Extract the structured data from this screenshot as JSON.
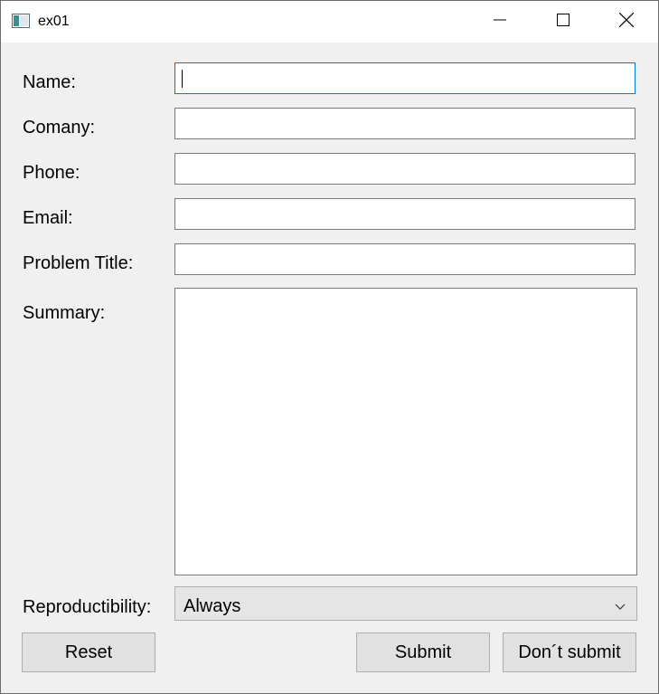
{
  "window": {
    "title": "ex01",
    "icon": "app-window-icon",
    "controls": {
      "minimize": "minimize-icon",
      "maximize": "maximize-icon",
      "close": "close-icon"
    }
  },
  "form": {
    "labels": {
      "name": "Name:",
      "company": "Comany:",
      "phone": "Phone:",
      "email": "Email:",
      "problem_title": "Problem Title:",
      "summary": "Summary:",
      "reproductibility": "Reproductibility:"
    },
    "values": {
      "name": "",
      "company": "",
      "phone": "",
      "email": "",
      "problem_title": "",
      "summary": ""
    },
    "reproductibility": {
      "selected": "Always"
    }
  },
  "buttons": {
    "reset": "Reset",
    "submit": "Submit",
    "dont_submit": "Don´t submit"
  },
  "colors": {
    "window_bg": "#f0f0f0",
    "titlebar_bg": "#ffffff",
    "focus_border": "#0078d7",
    "field_border": "#7a7a7a",
    "button_bg": "#e1e1e1"
  }
}
